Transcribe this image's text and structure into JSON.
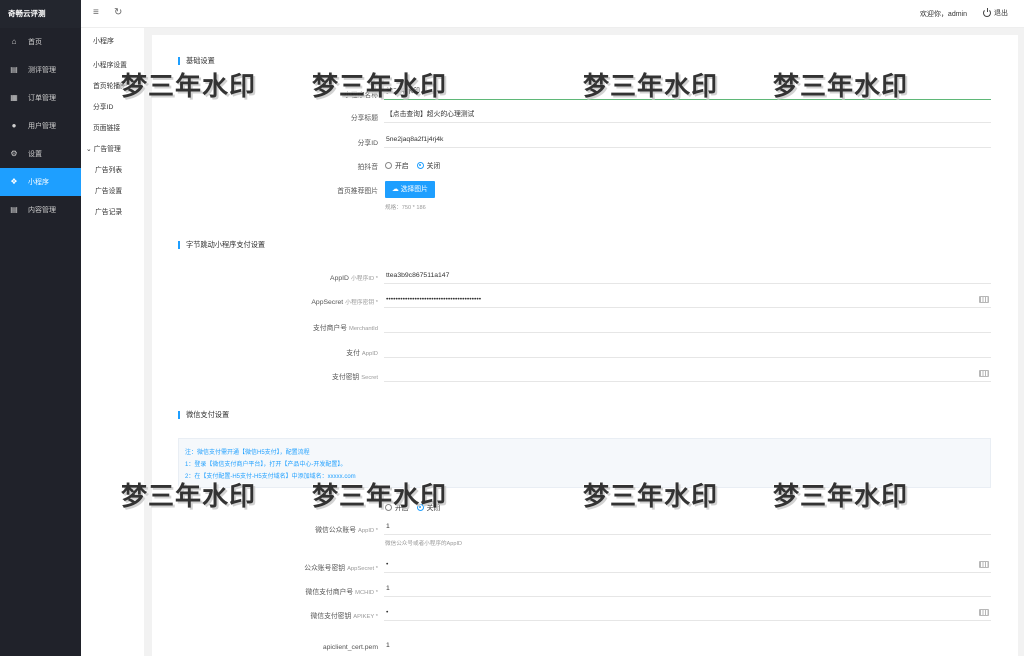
{
  "sidebar": {
    "brand": "奇畅云评测",
    "items": [
      {
        "icon": "home-icon",
        "label": "首页"
      },
      {
        "icon": "document-icon",
        "label": "测评管理"
      },
      {
        "icon": "order-icon",
        "label": "订单管理"
      },
      {
        "icon": "user-icon",
        "label": "用户管理"
      },
      {
        "icon": "gear-icon",
        "label": "设置"
      },
      {
        "icon": "miniapp-icon",
        "label": "小程序"
      },
      {
        "icon": "document-icon",
        "label": "内容管理"
      }
    ],
    "active_index": 5
  },
  "topbar": {
    "welcome": "欢迎你，admin",
    "logout": "退出"
  },
  "submenu": {
    "title": "小程序",
    "items": [
      "小程序设置",
      "首页轮播图",
      "分享ID",
      "页面链接"
    ],
    "group": "广告管理",
    "group_items": [
      "广告列表",
      "广告设置",
      "广告记录"
    ]
  },
  "basic": {
    "section_title": "基础设置",
    "mini_name_label": "小程序名称",
    "mini_name_value": "梦三年水印",
    "share_title_label": "分享标题",
    "share_title_value": "【点击查询】超火的心理测试",
    "share_id_label": "分享ID",
    "share_id_value": "5ne2jaq8a2f1j4rj4k",
    "douyin_label": "拍抖音",
    "radio_on": "开启",
    "radio_off": "关闭",
    "home_img_label": "首页推荐图片",
    "select_btn": "选择图片",
    "size_hint": "规格：750 * 186"
  },
  "bytedance": {
    "section_title": "字节跳动小程序支付设置",
    "appid_label": "AppID",
    "appid_sub": "小程序ID *",
    "appid_value": "ttea3b9c867511a147",
    "secret_label": "AppSecret",
    "secret_sub": "小程序密钥 *",
    "secret_value": "••••••••••••••••••••••••••••••••••••••••",
    "merchant_label": "支付商户号",
    "merchant_sub": "MerchantId",
    "merchant_value": "",
    "pay_appid_label": "支付",
    "pay_appid_sub": "AppID",
    "pay_appid_value": "",
    "pay_secret_label": "支付密钥",
    "pay_secret_sub": "Secret",
    "pay_secret_value": ""
  },
  "wechat": {
    "section_title": "微信支付设置",
    "notice": [
      "注：微信支付需开通【微信H5支付】，配置流程",
      "1：登录【微信支付商户平台】，打开【产品中心-开发配置】。",
      "2：在【支付配置-H5支付-H5支付域名】中添加域名：xxxxx.com"
    ],
    "radio_on": "开启",
    "radio_off": "关闭",
    "mp_appid_label": "微信公众账号",
    "mp_appid_sub": "AppID *",
    "mp_appid_value": "1",
    "mp_appid_hint": "微信公众号或者小程序的AppID",
    "mp_secret_label": "公众账号密钥",
    "mp_secret_sub": "AppSecret *",
    "mp_secret_value": "•",
    "mchid_label": "微信支付商户号",
    "mchid_sub": "MCHID *",
    "mchid_value": "1",
    "apikey_label": "微信支付密钥",
    "apikey_sub": "APIKEY *",
    "apikey_value": "•",
    "cert_label": "apiclient_cert.pem",
    "cert_value": "1"
  },
  "watermark": "梦三年水印"
}
